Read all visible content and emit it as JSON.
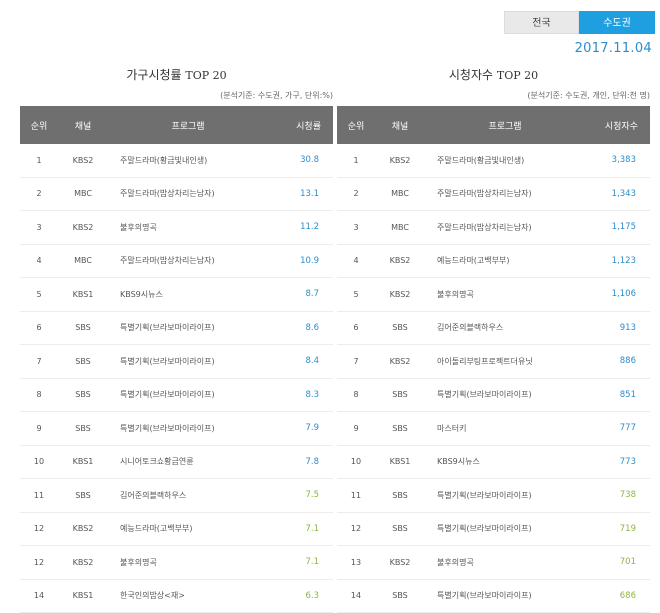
{
  "region_tabs": [
    {
      "label": "전국",
      "active": false
    },
    {
      "label": "수도권",
      "active": true
    }
  ],
  "date": "2017.11.04",
  "colors": {
    "accent": "#1f9ee0",
    "value_blue": "#2b8dcf",
    "value_green": "#8cb640",
    "header_bg": "#6f6f6f"
  },
  "household": {
    "title": "가구시청률",
    "title_suffix": "TOP 20",
    "note": "(분석기준: 수도권, 가구, 단위:%)",
    "headers": {
      "rank": "순위",
      "channel": "채널",
      "program": "프로그램",
      "value": "시청률"
    },
    "rows": [
      {
        "rank": "1",
        "channel": "KBS2",
        "program": "주말드라마(황금빛내인생)",
        "value": "30.8",
        "tone": "blue"
      },
      {
        "rank": "2",
        "channel": "MBC",
        "program": "주말드라마(밥상차리는남자)",
        "value": "13.1",
        "tone": "blue"
      },
      {
        "rank": "3",
        "channel": "KBS2",
        "program": "불후의명곡",
        "value": "11.2",
        "tone": "blue"
      },
      {
        "rank": "4",
        "channel": "MBC",
        "program": "주말드라마(밥상차리는남자)",
        "value": "10.9",
        "tone": "blue"
      },
      {
        "rank": "5",
        "channel": "KBS1",
        "program": "KBS9시뉴스",
        "value": "8.7",
        "tone": "blue"
      },
      {
        "rank": "6",
        "channel": "SBS",
        "program": "특별기획(브라보마이라이프)",
        "value": "8.6",
        "tone": "blue"
      },
      {
        "rank": "7",
        "channel": "SBS",
        "program": "특별기획(브라보마이라이프)",
        "value": "8.4",
        "tone": "blue"
      },
      {
        "rank": "8",
        "channel": "SBS",
        "program": "특별기획(브라보마이라이프)",
        "value": "8.3",
        "tone": "blue"
      },
      {
        "rank": "9",
        "channel": "SBS",
        "program": "특별기획(브라보마이라이프)",
        "value": "7.9",
        "tone": "blue"
      },
      {
        "rank": "10",
        "channel": "KBS1",
        "program": "시니어토크쇼황금연륜",
        "value": "7.8",
        "tone": "blue"
      },
      {
        "rank": "11",
        "channel": "SBS",
        "program": "김어준의블랙하우스",
        "value": "7.5",
        "tone": "green"
      },
      {
        "rank": "12",
        "channel": "KBS2",
        "program": "예능드라마(고백부부)",
        "value": "7.1",
        "tone": "green"
      },
      {
        "rank": "12",
        "channel": "KBS2",
        "program": "불후의명곡",
        "value": "7.1",
        "tone": "green"
      },
      {
        "rank": "14",
        "channel": "KBS1",
        "program": "한국인의밥상<재>",
        "value": "6.3",
        "tone": "green"
      }
    ]
  },
  "viewers": {
    "title": "시청자수",
    "title_suffix": "TOP 20",
    "note": "(분석기준: 수도권, 개인, 단위:천 명)",
    "headers": {
      "rank": "순위",
      "channel": "채널",
      "program": "프로그램",
      "value": "시청자수"
    },
    "rows": [
      {
        "rank": "1",
        "channel": "KBS2",
        "program": "주말드라마(황금빛내인생)",
        "value": "3,383",
        "tone": "blue"
      },
      {
        "rank": "2",
        "channel": "MBC",
        "program": "주말드라마(밥상차리는남자)",
        "value": "1,343",
        "tone": "blue"
      },
      {
        "rank": "3",
        "channel": "MBC",
        "program": "주말드라마(밥상차리는남자)",
        "value": "1,175",
        "tone": "blue"
      },
      {
        "rank": "4",
        "channel": "KBS2",
        "program": "예능드라마(고백부부)",
        "value": "1,123",
        "tone": "blue"
      },
      {
        "rank": "5",
        "channel": "KBS2",
        "program": "불후의명곡",
        "value": "1,106",
        "tone": "blue"
      },
      {
        "rank": "6",
        "channel": "SBS",
        "program": "김어준의블랙하우스",
        "value": "913",
        "tone": "blue"
      },
      {
        "rank": "7",
        "channel": "KBS2",
        "program": "아이돌리부팅프로젝트더유닛",
        "value": "886",
        "tone": "blue"
      },
      {
        "rank": "8",
        "channel": "SBS",
        "program": "특별기획(브라보마이라이프)",
        "value": "851",
        "tone": "blue"
      },
      {
        "rank": "9",
        "channel": "SBS",
        "program": "마스터키",
        "value": "777",
        "tone": "blue"
      },
      {
        "rank": "10",
        "channel": "KBS1",
        "program": "KBS9시뉴스",
        "value": "773",
        "tone": "blue"
      },
      {
        "rank": "11",
        "channel": "SBS",
        "program": "특별기획(브라보마이라이프)",
        "value": "738",
        "tone": "green"
      },
      {
        "rank": "12",
        "channel": "SBS",
        "program": "특별기획(브라보마이라이프)",
        "value": "719",
        "tone": "green"
      },
      {
        "rank": "13",
        "channel": "KBS2",
        "program": "불후의명곡",
        "value": "701",
        "tone": "green"
      },
      {
        "rank": "14",
        "channel": "SBS",
        "program": "특별기획(브라보마이라이프)",
        "value": "686",
        "tone": "green"
      }
    ]
  }
}
